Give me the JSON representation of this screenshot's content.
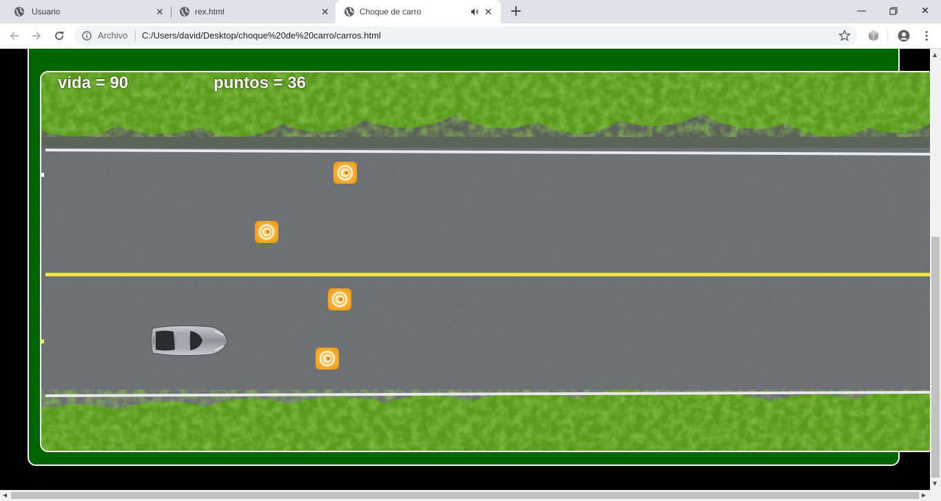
{
  "browser": {
    "tabs": [
      {
        "title": "Usuario"
      },
      {
        "title": "rex.html"
      },
      {
        "title": "Choque de carro",
        "active": true,
        "audio": true
      }
    ],
    "address": {
      "scheme_label": "Archivo",
      "url": "C:/Users/david/Desktop/choque%20de%20carro/carros.html"
    },
    "icons": {
      "back": "arrow-left-icon",
      "forward": "arrow-right-icon",
      "reload": "reload-icon",
      "info": "info-icon",
      "bookmark": "star-icon",
      "extension": "extension-cube-icon",
      "profile": "profile-icon",
      "menu": "kebab-menu-icon"
    }
  },
  "game": {
    "hud": {
      "vida_label": "vida = 90",
      "puntos_label": "puntos = 36"
    },
    "colors": {
      "frame_green": "#006400",
      "lane_yellow": "#f5e642",
      "lane_white": "#e8e8e8",
      "cone_orange": "#f5a623"
    },
    "obstacles_count": 4,
    "player": "silver-car"
  }
}
